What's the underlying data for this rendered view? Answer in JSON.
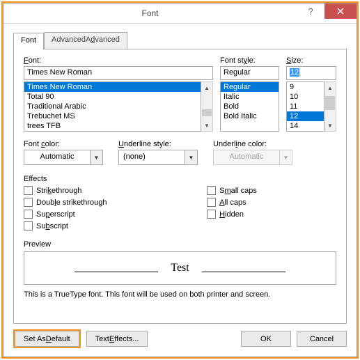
{
  "title": "Font",
  "tabs": {
    "font": "Font",
    "advanced": "Advanced"
  },
  "fontSection": {
    "label_html": "<u>F</u>ont:",
    "value": "Times New Roman",
    "items": [
      "Times New Roman",
      "Total 90",
      "Traditional Arabic",
      "Trebuchet MS",
      "trees TFB"
    ],
    "selectedIndex": 0
  },
  "styleSection": {
    "label_html": "Font st<u>y</u>le:",
    "value": "Regular",
    "items": [
      "Regular",
      "Italic",
      "Bold",
      "Bold Italic"
    ],
    "selectedIndex": 0
  },
  "sizeSection": {
    "label_html": "<u>S</u>ize:",
    "value": "12",
    "items": [
      "9",
      "10",
      "11",
      "12",
      "14"
    ],
    "selectedIndex": 3
  },
  "colorRow": {
    "fontColor": {
      "label_html": "Font <u>c</u>olor:",
      "value": "Automatic"
    },
    "underlineStyle": {
      "label_html": "<u>U</u>nderline style:",
      "value": "(none)"
    },
    "underlineColor": {
      "label_html": "Underl<u>i</u>ne color:",
      "value": "Automatic"
    }
  },
  "effects": {
    "label": "Effects",
    "left": [
      {
        "label_html": "Stri<u>k</u>ethrough"
      },
      {
        "label_html": "Doub<u>l</u>e strikethrough"
      },
      {
        "label_html": "Su<u>p</u>erscript"
      },
      {
        "label_html": "Su<u>b</u>script"
      }
    ],
    "right": [
      {
        "label_html": "S<u>m</u>all caps"
      },
      {
        "label_html": "<u>A</u>ll caps"
      },
      {
        "label_html": "<u>H</u>idden"
      }
    ]
  },
  "preview": {
    "label": "Preview",
    "sample": "Test"
  },
  "note": "This is a TrueType font. This font will be used on both printer and screen.",
  "buttons": {
    "setDefault_html": "Set As <u>D</u>efault",
    "textEffects_html": "Text <u>E</u>ffects...",
    "ok": "OK",
    "cancel": "Cancel"
  }
}
